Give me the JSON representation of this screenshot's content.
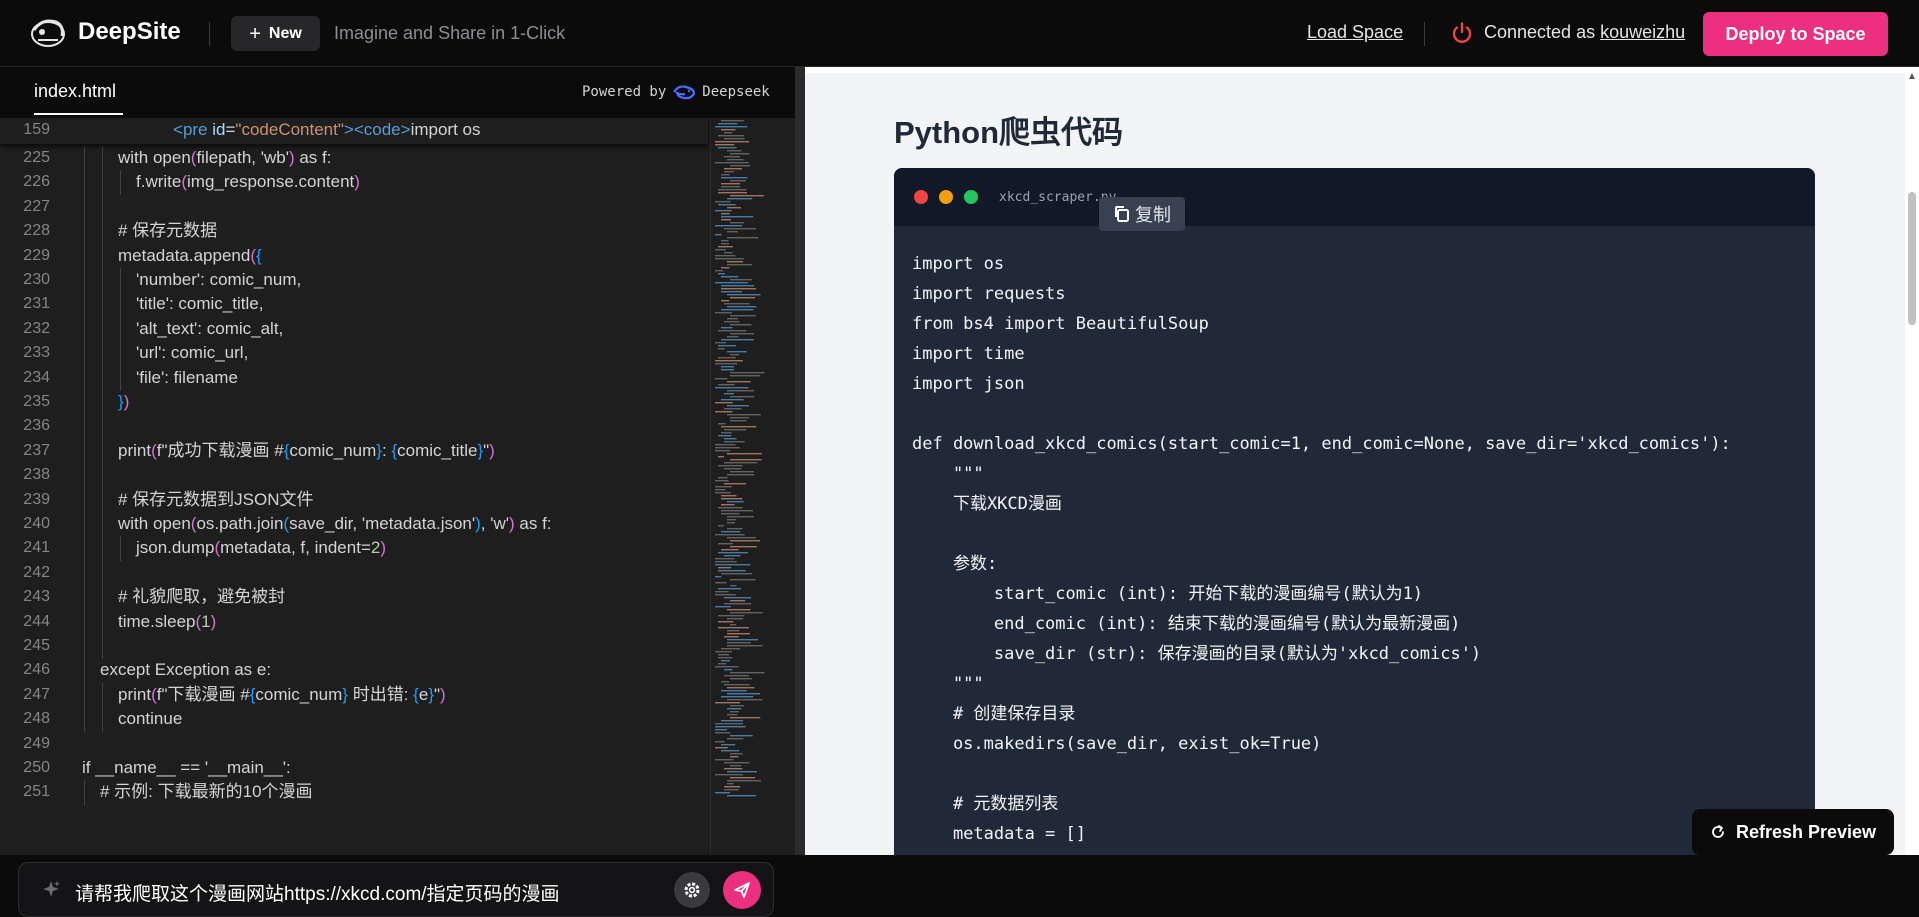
{
  "header": {
    "brand": "DeepSite",
    "new_label": "New",
    "tagline": "Imagine and Share in 1-Click",
    "load_space": "Load Space",
    "connected_prefix": "Connected as",
    "username": "kouweizhu",
    "deploy_label": "Deploy to Space"
  },
  "editor": {
    "tab_label": "index.html",
    "powered_by": "Powered by",
    "powered_brand": "Deepseek",
    "sticky_line": {
      "number": "159",
      "parts": [
        {
          "t": "<",
          "c": "k-tag"
        },
        {
          "t": "pre",
          "c": "k-tag"
        },
        {
          "t": " ",
          "c": ""
        },
        {
          "t": "id",
          "c": "k-attr"
        },
        {
          "t": "=",
          "c": ""
        },
        {
          "t": "\"codeContent\"",
          "c": "k-str"
        },
        {
          "t": "><",
          "c": "k-tag"
        },
        {
          "t": "code",
          "c": "k-tag"
        },
        {
          "t": ">",
          "c": "k-tag"
        },
        {
          "t": "import os",
          "c": ""
        }
      ]
    },
    "lines": [
      {
        "n": "225",
        "indent": 2,
        "parts": [
          {
            "t": "with open",
            "c": ""
          },
          {
            "t": "(",
            "c": "k-br2"
          },
          {
            "t": "filepath, 'wb'",
            "c": ""
          },
          {
            "t": ")",
            "c": "k-br2"
          },
          {
            "t": " as f:",
            "c": ""
          }
        ]
      },
      {
        "n": "226",
        "indent": 3,
        "parts": [
          {
            "t": "f.write",
            "c": ""
          },
          {
            "t": "(",
            "c": "k-br2"
          },
          {
            "t": "img_response.content",
            "c": ""
          },
          {
            "t": ")",
            "c": "k-br2"
          }
        ]
      },
      {
        "n": "227",
        "indent": 0,
        "parts": []
      },
      {
        "n": "228",
        "indent": 2,
        "parts": [
          {
            "t": "# 保存元数据",
            "c": ""
          }
        ]
      },
      {
        "n": "229",
        "indent": 2,
        "parts": [
          {
            "t": "metadata.append",
            "c": ""
          },
          {
            "t": "(",
            "c": "k-br2"
          },
          {
            "t": "{",
            "c": "k-br3"
          }
        ]
      },
      {
        "n": "230",
        "indent": 3,
        "parts": [
          {
            "t": "'number': comic_num,",
            "c": ""
          }
        ]
      },
      {
        "n": "231",
        "indent": 3,
        "parts": [
          {
            "t": "'title': comic_title,",
            "c": ""
          }
        ]
      },
      {
        "n": "232",
        "indent": 3,
        "parts": [
          {
            "t": "'alt_text': comic_alt,",
            "c": ""
          }
        ]
      },
      {
        "n": "233",
        "indent": 3,
        "parts": [
          {
            "t": "'url': comic_url,",
            "c": ""
          }
        ]
      },
      {
        "n": "234",
        "indent": 3,
        "parts": [
          {
            "t": "'file': filename",
            "c": ""
          }
        ]
      },
      {
        "n": "235",
        "indent": 2,
        "parts": [
          {
            "t": "}",
            "c": "k-br3"
          },
          {
            "t": ")",
            "c": "k-br2"
          }
        ]
      },
      {
        "n": "236",
        "indent": 0,
        "parts": []
      },
      {
        "n": "237",
        "indent": 2,
        "parts": [
          {
            "t": "print",
            "c": ""
          },
          {
            "t": "(",
            "c": "k-br2"
          },
          {
            "t": "f\"成功下载漫画 #",
            "c": ""
          },
          {
            "t": "{",
            "c": "k-br3"
          },
          {
            "t": "comic_num",
            "c": ""
          },
          {
            "t": "}",
            "c": "k-br3"
          },
          {
            "t": ": ",
            "c": ""
          },
          {
            "t": "{",
            "c": "k-br3"
          },
          {
            "t": "comic_title",
            "c": ""
          },
          {
            "t": "}",
            "c": "k-br3"
          },
          {
            "t": "\"",
            "c": ""
          },
          {
            "t": ")",
            "c": "k-br2"
          }
        ]
      },
      {
        "n": "238",
        "indent": 0,
        "parts": []
      },
      {
        "n": "239",
        "indent": 2,
        "parts": [
          {
            "t": "# 保存元数据到JSON文件",
            "c": ""
          }
        ]
      },
      {
        "n": "240",
        "indent": 2,
        "parts": [
          {
            "t": "with open",
            "c": ""
          },
          {
            "t": "(",
            "c": "k-br2"
          },
          {
            "t": "os.path.join",
            "c": ""
          },
          {
            "t": "(",
            "c": "k-br3"
          },
          {
            "t": "save_dir, 'metadata.json'",
            "c": ""
          },
          {
            "t": ")",
            "c": "k-br3"
          },
          {
            "t": ", 'w'",
            "c": ""
          },
          {
            "t": ")",
            "c": "k-br2"
          },
          {
            "t": " as f:",
            "c": ""
          }
        ]
      },
      {
        "n": "241",
        "indent": 3,
        "parts": [
          {
            "t": "json.dump",
            "c": ""
          },
          {
            "t": "(",
            "c": "k-br2"
          },
          {
            "t": "metadata, f, indent=",
            "c": ""
          },
          {
            "t": "2",
            "c": "k-num"
          },
          {
            "t": ")",
            "c": "k-br2"
          }
        ]
      },
      {
        "n": "242",
        "indent": 0,
        "parts": []
      },
      {
        "n": "243",
        "indent": 2,
        "parts": [
          {
            "t": "# 礼貌爬取，避免被封",
            "c": ""
          }
        ]
      },
      {
        "n": "244",
        "indent": 2,
        "parts": [
          {
            "t": "time.sleep",
            "c": ""
          },
          {
            "t": "(",
            "c": "k-br2"
          },
          {
            "t": "1",
            "c": "k-num"
          },
          {
            "t": ")",
            "c": "k-br2"
          }
        ]
      },
      {
        "n": "245",
        "indent": 0,
        "parts": []
      },
      {
        "n": "246",
        "indent": 1,
        "parts": [
          {
            "t": "except Exception as e:",
            "c": ""
          }
        ]
      },
      {
        "n": "247",
        "indent": 2,
        "parts": [
          {
            "t": "print",
            "c": ""
          },
          {
            "t": "(",
            "c": "k-br2"
          },
          {
            "t": "f\"下载漫画 #",
            "c": ""
          },
          {
            "t": "{",
            "c": "k-br3"
          },
          {
            "t": "comic_num",
            "c": ""
          },
          {
            "t": "}",
            "c": "k-br3"
          },
          {
            "t": " 时出错: ",
            "c": ""
          },
          {
            "t": "{",
            "c": "k-br3"
          },
          {
            "t": "e",
            "c": ""
          },
          {
            "t": "}",
            "c": "k-br3"
          },
          {
            "t": "\"",
            "c": ""
          },
          {
            "t": ")",
            "c": "k-br2"
          }
        ]
      },
      {
        "n": "248",
        "indent": 2,
        "parts": [
          {
            "t": "continue",
            "c": ""
          }
        ]
      },
      {
        "n": "249",
        "indent": 0,
        "parts": []
      },
      {
        "n": "250",
        "indent": 0,
        "parts": [
          {
            "t": "if __name__ == '__main__':",
            "c": ""
          }
        ]
      },
      {
        "n": "251",
        "indent": 1,
        "parts": [
          {
            "t": "# 示例: 下载最新的10个漫画",
            "c": ""
          }
        ]
      }
    ]
  },
  "prompt": {
    "value": "请帮我爬取这个漫画网站https://xkcd.com/指定页码的漫画"
  },
  "preview": {
    "title": "Python爬虫代码",
    "filename": "xkcd_scraper.py",
    "copy_label": "复制",
    "code_lines": [
      "import os",
      "import requests",
      "from bs4 import BeautifulSoup",
      "import time",
      "import json",
      "",
      "def download_xkcd_comics(start_comic=1, end_comic=None, save_dir='xkcd_comics'):",
      "    \"\"\"",
      "    下载XKCD漫画",
      "",
      "    参数:",
      "        start_comic (int): 开始下载的漫画编号(默认为1)",
      "        end_comic (int): 结束下载的漫画编号(默认为最新漫画)",
      "        save_dir (str): 保存漫画的目录(默认为'xkcd_comics')",
      "    \"\"\"",
      "    # 创建保存目录",
      "    os.makedirs(save_dir, exist_ok=True)",
      "",
      "    # 元数据列表",
      "    metadata = []"
    ],
    "refresh_label": "Refresh Preview"
  },
  "colors": {
    "accent": "#ec2f7f",
    "editor_bg": "#1e1e1e",
    "header_bg": "#0b0b0c",
    "card_bg": "#1f2937",
    "dot_red": "#ef4444",
    "dot_yellow": "#f59e0b",
    "dot_green": "#22c55e"
  }
}
